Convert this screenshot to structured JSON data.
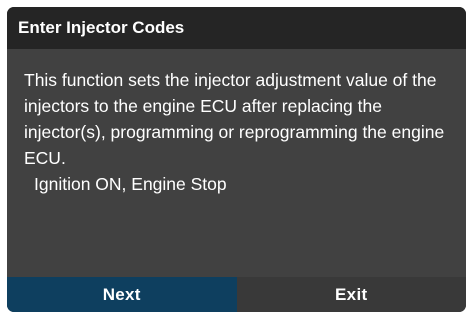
{
  "dialog": {
    "title": "Enter Injector Codes",
    "message": "This function sets the injector adjustment value of the injectors to the engine ECU after replacing the injector(s), programming or reprogramming the engine ECU.",
    "condition": "Ignition ON, Engine Stop"
  },
  "buttons": {
    "next_label": "Next",
    "exit_label": "Exit"
  },
  "colors": {
    "dialog_background": "#414141",
    "title_background": "#252525",
    "next_button": "#0e3f5f",
    "exit_button": "#393939",
    "text": "#ffffff"
  }
}
